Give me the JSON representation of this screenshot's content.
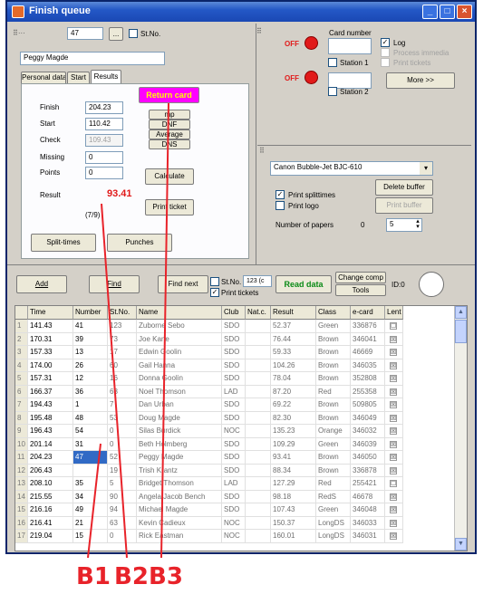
{
  "window": {
    "title": "Finish queue",
    "controls": [
      "_",
      "□",
      "×"
    ]
  },
  "top_left": {
    "number_value": "47",
    "ellipsis_label": "...",
    "stno_label": "St.No.",
    "name_value": "Peggy Magde",
    "tabs": [
      "Personal data",
      "Start",
      "Results"
    ],
    "return_card_label": "Return card",
    "finish_label": "Finish",
    "finish_value": "204.23",
    "start_label": "Start",
    "start_value": "110.42",
    "check_label": "Check",
    "check_value": "109.43",
    "missing_label": "Missing",
    "missing_value": "0",
    "points_label": "Points",
    "points_value": "0",
    "mp_label": "mp",
    "dnf_label": "DNF",
    "average_label": "Average",
    "dns_label": "DNS",
    "calculate_label": "Calculate",
    "result_label": "Result",
    "result_value": "93.41",
    "place_value": "(7/9)",
    "print_ticket_label": "Print ticket",
    "split_times_label": "Split-times",
    "punches_label": "Punches"
  },
  "top_right": {
    "card_number_label": "Card number",
    "off1": "OFF",
    "off2": "OFF",
    "station1_label": "Station 1",
    "station2_label": "Station 2",
    "log_label": "Log",
    "process_label": "Process immedia",
    "print_tickets_label": "Print tickets",
    "more_label": "More >>",
    "log_checked": true,
    "process_checked": false,
    "print_tickets_checked": false,
    "colors": {
      "indicator": "#e11a1a"
    }
  },
  "printer": {
    "printer_name": "Canon Bubble-Jet BJC-610",
    "delete_buffer_label": "Delete buffer",
    "print_buffer_label": "Print buffer",
    "print_splittimes_label": "Print splittimes",
    "print_logo_label": "Print logo",
    "number_of_papers_label": "Number of papers",
    "papers_in_buffer": "0",
    "papers_value": "5"
  },
  "toolbar": {
    "add_label": "Add",
    "find_label": "Find",
    "find_next_label": "Find next",
    "stno_label": "St.No.",
    "stno_value": "123 (c",
    "print_tickets_label": "Print tickets",
    "read_data_label": "Read data",
    "change_comp_label": "Change comp",
    "tools_label": "Tools",
    "id_label": "ID:0"
  },
  "table": {
    "columns": [
      "",
      "Time",
      "Number",
      "St.No.",
      "Name",
      "Club",
      "Nat.c.",
      "Result",
      "Class",
      "e-card",
      "Lent"
    ],
    "rows": [
      [
        "1",
        "141.43",
        "41",
        "123",
        "Zuborne Sebo",
        "SDO",
        "",
        "52.37",
        "Green",
        "336876",
        "☐"
      ],
      [
        "2",
        "170.31",
        "39",
        "73",
        "Joe Kane",
        "SDO",
        "",
        "76.44",
        "Brown",
        "346041",
        "☒"
      ],
      [
        "3",
        "157.33",
        "13",
        "17",
        "Edwin Goolin",
        "SDO",
        "",
        "59.33",
        "Brown",
        "46669",
        "☒"
      ],
      [
        "4",
        "174.00",
        "26",
        "60",
        "Gail Hanna",
        "SDO",
        "",
        "104.26",
        "Brown",
        "346035",
        "☒"
      ],
      [
        "5",
        "157.31",
        "12",
        "16",
        "Donna Goolin",
        "SDO",
        "",
        "78.04",
        "Brown",
        "352808",
        "☒"
      ],
      [
        "6",
        "166.37",
        "36",
        "68",
        "Noel Thomson",
        "LAD",
        "",
        "87.20",
        "Red",
        "255358",
        "☒"
      ],
      [
        "7",
        "194.43",
        "1",
        "7",
        "Dan Urban",
        "SDO",
        "",
        "69.22",
        "Brown",
        "509805",
        "☒"
      ],
      [
        "8",
        "195.48",
        "48",
        "53",
        "Doug Magde",
        "SDO",
        "",
        "82.30",
        "Brown",
        "346049",
        "☒"
      ],
      [
        "9",
        "196.43",
        "54",
        "0",
        "Silas Burdick",
        "NOC",
        "",
        "135.23",
        "Orange",
        "346032",
        "☒"
      ],
      [
        "10",
        "201.14",
        "31",
        "0",
        "Beth Holmberg",
        "SDO",
        "",
        "109.29",
        "Green",
        "346039",
        "☒"
      ],
      [
        "11",
        "204.23",
        "47",
        "52",
        "Peggy Magde",
        "SDO",
        "",
        "93.41",
        "Brown",
        "346050",
        "☒"
      ],
      [
        "12",
        "206.43",
        "",
        "19",
        "Trish Krantz",
        "SDO",
        "",
        "88.34",
        "Brown",
        "336878",
        "☒"
      ],
      [
        "13",
        "208.10",
        "35",
        "5",
        "Bridget Thomson",
        "LAD",
        "",
        "127.29",
        "Red",
        "255421",
        "☐"
      ],
      [
        "14",
        "215.55",
        "34",
        "90",
        "Angela Jacob Bench",
        "SDO",
        "",
        "98.18",
        "RedS",
        "46678",
        "☒"
      ],
      [
        "15",
        "216.16",
        "49",
        "94",
        "Michael Magde",
        "SDO",
        "",
        "107.43",
        "Green",
        "346048",
        "☒"
      ],
      [
        "16",
        "216.41",
        "21",
        "63",
        "Kevin Cadieux",
        "NOC",
        "",
        "150.37",
        "LongDS",
        "346033",
        "☒"
      ],
      [
        "17",
        "219.04",
        "15",
        "0",
        "Rick Eastman",
        "NOC",
        "",
        "160.01",
        "LongDS",
        "346031",
        "☒"
      ]
    ]
  },
  "annotations": [
    "B1",
    "B2",
    "B3"
  ],
  "colors": {
    "return_card_bg": "#ff00ff",
    "return_card_text": "#ffff00",
    "result_value": "#e11a1a",
    "read_data_text": "#0a8a16",
    "annotation": "#e8232a"
  }
}
